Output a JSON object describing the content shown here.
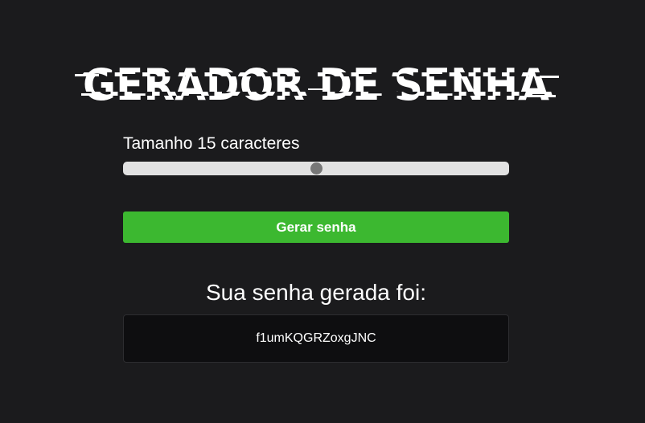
{
  "header": {
    "title": "GERADOR DE SENHA"
  },
  "length_control": {
    "label": "Tamanho 15 caracteres",
    "value_fraction": 0.5
  },
  "generate_button": {
    "label": "Gerar senha"
  },
  "result": {
    "title": "Sua senha gerada foi:",
    "password": "f1umKQGRZoxgJNC"
  },
  "colors": {
    "background": "#1b1b1d",
    "button": "#3cb830",
    "slider_track": "#e2e2e2",
    "slider_thumb": "#777777"
  }
}
